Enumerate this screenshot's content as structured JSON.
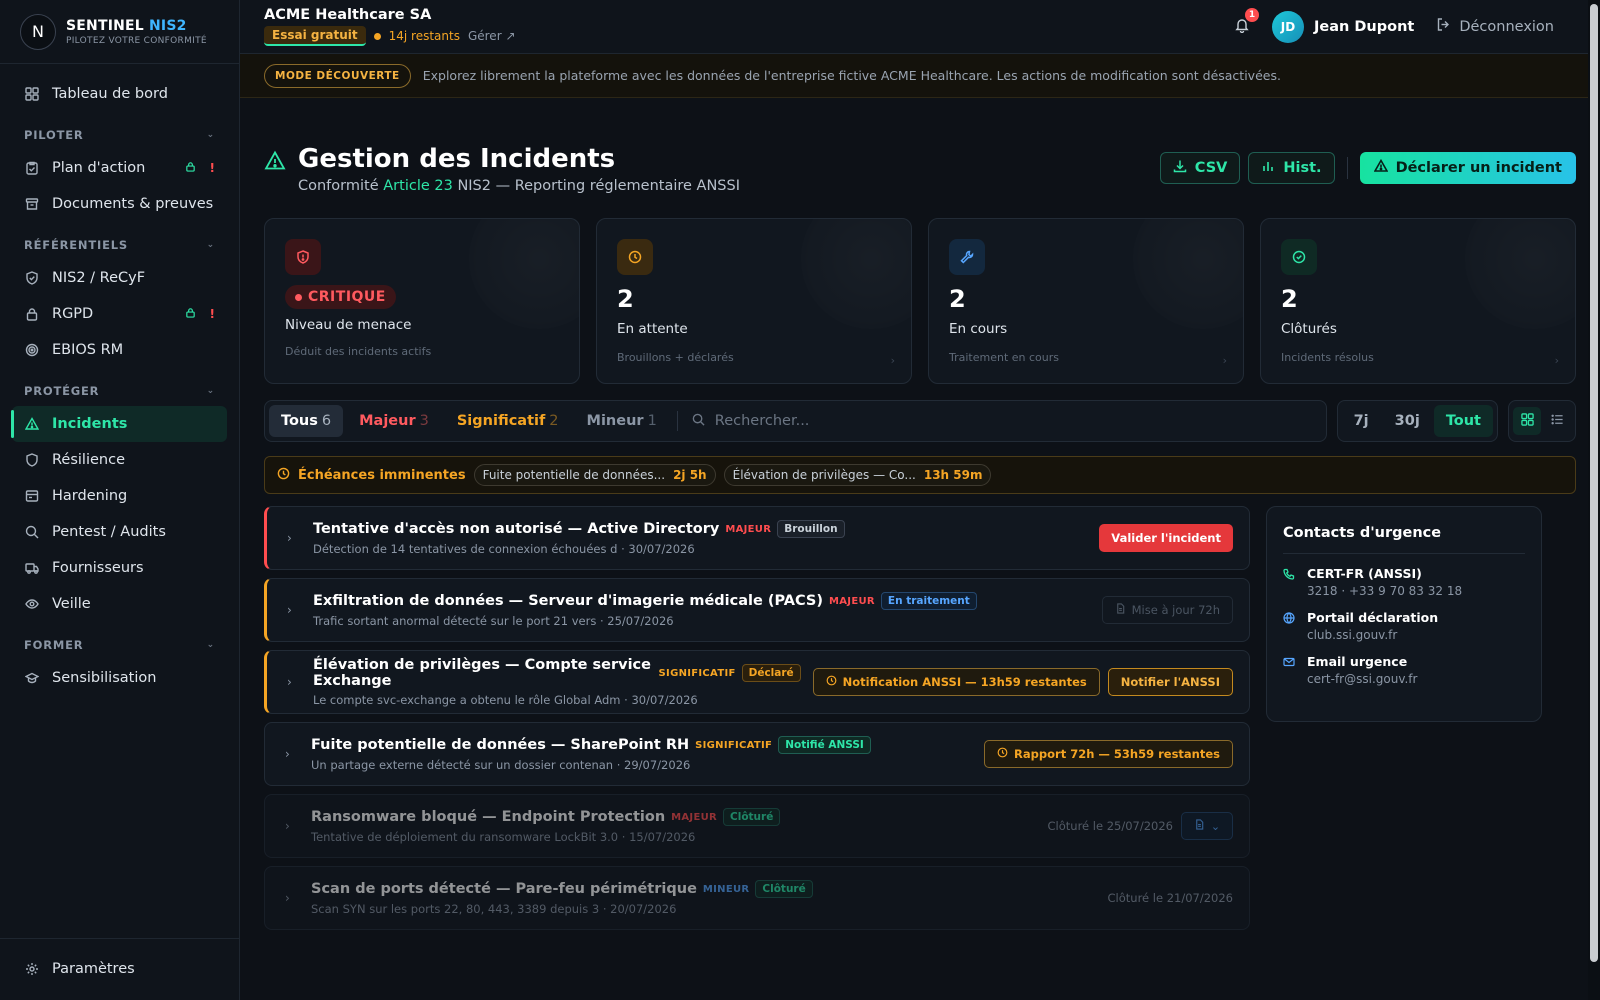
{
  "brand": {
    "name_main": "SENTINEL",
    "name_accent": "NIS2",
    "tagline": "PILOTEZ VOTRE CONFORMITÉ",
    "logo_letter": "N"
  },
  "sidebar": {
    "dashboard": "Tableau de bord",
    "sections": {
      "piloter": "PILOTER",
      "referentiels": "RÉFÉRENTIELS",
      "proteger": "PROTÉGER",
      "former": "FORMER"
    },
    "items": {
      "plan": "Plan d'action",
      "documents": "Documents & preuves",
      "nis2": "NIS2 / ReCyF",
      "rgpd": "RGPD",
      "ebios": "EBIOS RM",
      "incidents": "Incidents",
      "resilience": "Résilience",
      "hardening": "Hardening",
      "pentest": "Pentest / Audits",
      "fournisseurs": "Fournisseurs",
      "veille": "Veille",
      "sensibilisation": "Sensibilisation"
    },
    "settings": "Paramètres",
    "excl": "!"
  },
  "topbar": {
    "org": "ACME Healthcare SA",
    "trial": "Essai gratuit",
    "days_left": "14j restants",
    "manage": "Gérer",
    "notif_count": "1",
    "user_initials": "JD",
    "user_name": "Jean Dupont",
    "logout": "Déconnexion"
  },
  "discover": {
    "badge": "MODE DÉCOUVERTE",
    "text": "Explorez librement la plateforme avec les données de l'entreprise fictive ACME Healthcare. Les actions de modification sont désactivées."
  },
  "page": {
    "title": "Gestion des Incidents",
    "subtitle_pre": "Conformité",
    "subtitle_accent": "Article 23",
    "subtitle_post": "NIS2 — Reporting réglementaire ANSSI",
    "csv": "CSV",
    "hist": "Hist.",
    "declare": "Déclarer un incident"
  },
  "stats": {
    "threat": {
      "level": "CRITIQUE",
      "label": "Niveau de menace",
      "hint": "Déduit des incidents actifs"
    },
    "pending": {
      "value": "2",
      "label": "En attente",
      "hint": "Brouillons + déclarés"
    },
    "progress": {
      "value": "2",
      "label": "En cours",
      "hint": "Traitement en cours"
    },
    "closed": {
      "value": "2",
      "label": "Clôturés",
      "hint": "Incidents résolus"
    }
  },
  "filters": {
    "all": {
      "label": "Tous",
      "count": "6"
    },
    "majeur": {
      "label": "Majeur",
      "count": "3"
    },
    "signif": {
      "label": "Significatif",
      "count": "2"
    },
    "mineur": {
      "label": "Mineur",
      "count": "1"
    },
    "search_placeholder": "Rechercher...",
    "periods": [
      "7j",
      "30j",
      "Tout"
    ]
  },
  "deadlines": {
    "title": "Échéances imminentes",
    "chips": [
      {
        "name": "Fuite potentielle de données...",
        "time": "2j 5h"
      },
      {
        "name": "Élévation de privilèges — Co...",
        "time": "13h 59m"
      }
    ]
  },
  "incidents": [
    {
      "title": "Tentative d'accès non autorisé — Active Directory",
      "severity": "MAJEUR",
      "status": "Brouillon",
      "desc": "Détection de 14 tentatives de connexion échouées d · 30/07/2026",
      "action": "Valider l'incident"
    },
    {
      "title": "Exfiltration de données — Serveur d'imagerie médicale (PACS)",
      "severity": "MAJEUR",
      "status": "En traitement",
      "desc": "Trafic sortant anormal détecté sur le port 21 vers · 25/07/2026",
      "action": "Mise à jour 72h"
    },
    {
      "title": "Élévation de privilèges — Compte service Exchange",
      "severity": "SIGNIFICATIF",
      "status": "Déclaré",
      "desc": "Le compte svc-exchange a obtenu le rôle Global Adm · 30/07/2026",
      "notice": "Notification ANSSI — 13h59 restantes",
      "action": "Notifier l'ANSSI"
    },
    {
      "title": "Fuite potentielle de données — SharePoint RH",
      "severity": "SIGNIFICATIF",
      "status": "Notifié ANSSI",
      "desc": "Un partage externe détecté sur un dossier contenan · 29/07/2026",
      "notice": "Rapport 72h — 53h59 restantes"
    },
    {
      "title": "Ransomware bloqué — Endpoint Protection",
      "severity": "MAJEUR",
      "status": "Clôturé",
      "desc": "Tentative de déploiement du ransomware LockBit 3.0 · 15/07/2026",
      "closed": "Clôturé le 25/07/2026"
    },
    {
      "title": "Scan de ports détecté — Pare-feu périmétrique",
      "severity": "MINEUR",
      "status": "Clôturé",
      "desc": "Scan SYN sur les ports 22, 80, 443, 3389 depuis 3 · 20/07/2026",
      "closed": "Clôturé le 21/07/2026"
    }
  ],
  "contacts": {
    "title": "Contacts d'urgence",
    "items": [
      {
        "name": "CERT-FR (ANSSI)",
        "value": "3218 · +33 9 70 83 32 18"
      },
      {
        "name": "Portail déclaration",
        "value": "club.ssi.gouv.fr"
      },
      {
        "name": "Email urgence",
        "value": "cert-fr@ssi.gouv.fr"
      }
    ]
  }
}
